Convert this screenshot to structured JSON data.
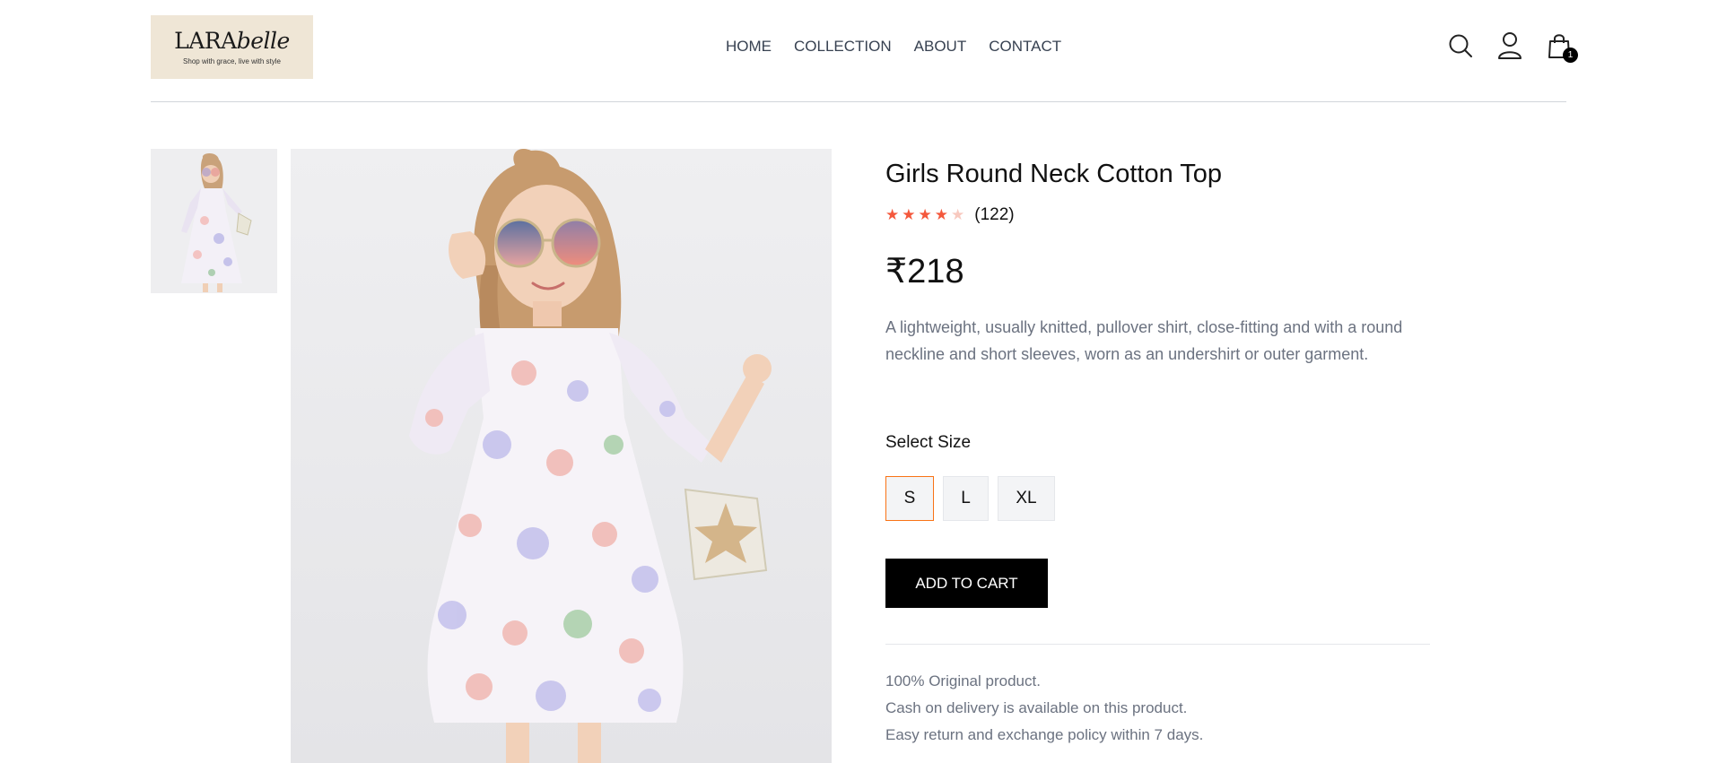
{
  "brand": {
    "name_regular": "LARA",
    "name_italic": "belle",
    "tagline": "Shop with grace, live with style",
    "bg_color": "#efe6d6"
  },
  "nav": {
    "items": [
      {
        "label": "HOME"
      },
      {
        "label": "COLLECTION"
      },
      {
        "label": "ABOUT"
      },
      {
        "label": "CONTACT"
      }
    ]
  },
  "header_icons": {
    "search": "search-icon",
    "profile": "user-icon",
    "cart": "shopping-bag-icon",
    "cart_count": "1"
  },
  "gallery": {
    "thumbnail": "product-thumbnail",
    "main_image": "product-main-image"
  },
  "product": {
    "title": "Girls Round Neck Cotton Top",
    "rating": {
      "value": 4,
      "max": 5,
      "count_label": "(122)",
      "filled_color": "#f4583c",
      "empty_color": "#f8c9bf"
    },
    "price": "₹218",
    "description": "A lightweight, usually knitted, pullover shirt, close-fitting and with a round neckline and short sleeves, worn as an undershirt or outer garment.",
    "size_label": "Select Size",
    "sizes": [
      {
        "label": "S",
        "selected": true
      },
      {
        "label": "L",
        "selected": false
      },
      {
        "label": "XL",
        "selected": false
      }
    ],
    "add_to_cart_label": "ADD TO CART",
    "notes": [
      "100% Original product.",
      "Cash on delivery is available on this product.",
      "Easy return and exchange policy within 7 days."
    ]
  },
  "colors": {
    "accent_selected_border": "#f97316",
    "button_bg": "#000000",
    "muted_text": "#6b7280"
  }
}
